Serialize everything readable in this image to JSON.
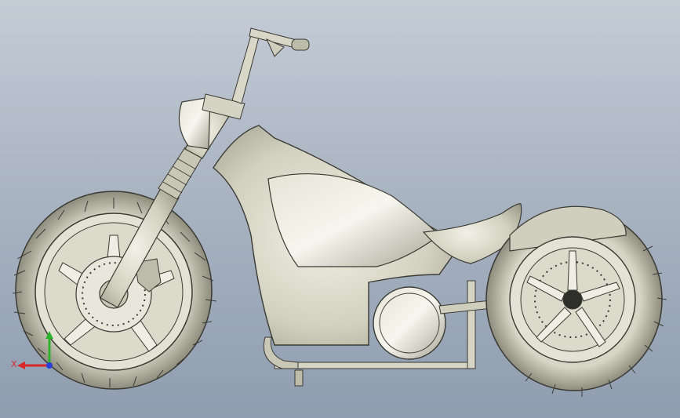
{
  "viewport": {
    "background_top": "#c4ccd6",
    "background_bottom": "#8f9db0",
    "model_fill": "#d6d4c4",
    "model_edge": "#3a3a34",
    "tire_fill": "#b9b7a5"
  },
  "triad": {
    "x_label": "X",
    "x_color": "#d8282a",
    "y_color": "#2bb32b",
    "z_color": "#2a3fd8"
  },
  "icons": [
    "coordinate-triad-icon"
  ]
}
